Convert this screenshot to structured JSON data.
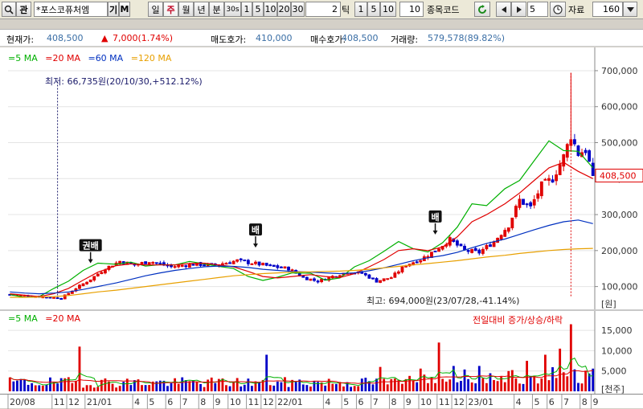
{
  "toolbar": {
    "search_icon": "search-icon",
    "code_btn": "관",
    "stock_name": "*포스코퓨처엠",
    "gi_btn": "기",
    "m_btn": "M",
    "periods": [
      "일",
      "주",
      "월",
      "년",
      "분",
      "30s"
    ],
    "period_selected": "주",
    "minute_opts": [
      "1",
      "5",
      "10",
      "20",
      "30"
    ],
    "tick_input": "2",
    "tick_label": "틱",
    "tick_opts": [
      "1",
      "5",
      "10"
    ],
    "tick_value": "10",
    "code_label": "종목코드",
    "count_value": "5",
    "data_label": "자료",
    "data_count": "160"
  },
  "info": {
    "current_label": "현재가:",
    "current_value": "408,500",
    "change_arrow": "▲",
    "change_value": "7,000(1.74%)",
    "ask_label": "매도호가:",
    "ask_value": "410,000",
    "bid_label": "매수호가:",
    "bid_value": "408,500",
    "volume_label": "거래량:",
    "volume_value": "579,578(89.82%)"
  },
  "price_legend": [
    {
      "label": "5 MA",
      "color": "#00b000"
    },
    {
      "label": "20 MA",
      "color": "#e00000"
    },
    {
      "label": "60 MA",
      "color": "#0030c0"
    },
    {
      "label": "120 MA",
      "color": "#e8a000"
    }
  ],
  "volume_legend": [
    {
      "label": "5 MA",
      "color": "#00b000"
    },
    {
      "label": "20 MA",
      "color": "#e00000"
    }
  ],
  "annotations": {
    "low": "최저: 66,735원(20/10/30,+512.12%)",
    "high": "최고: 694,000원(23/07/28,-41.14%)",
    "volume_title": "전일대비 증가/상승/하락",
    "markers": [
      "권배",
      "배",
      "배"
    ]
  },
  "colors": {
    "up": "#e00000",
    "down": "#0000c8",
    "badge_bg": "#e00000",
    "ma5": "#00b000",
    "ma20": "#e00000",
    "ma60": "#0030c0",
    "ma120": "#e8a000"
  },
  "chart_data": {
    "type": "candlestick",
    "price_axis": {
      "ticks": [
        "700,000",
        "600,000",
        "500,000",
        "400,000",
        "300,000",
        "200,000",
        "100,000"
      ],
      "unit": "[원]",
      "current_label": "408,500",
      "ylim": [
        50000,
        720000
      ]
    },
    "volume_axis": {
      "ticks": [
        "15,000",
        "10,000",
        "5,000"
      ],
      "unit": "[천주]",
      "ylim": [
        0,
        17000
      ]
    },
    "x_labels": [
      "20/08",
      "11",
      "12",
      "21/01",
      "4",
      "5",
      "6",
      "7",
      "8",
      "9",
      "10",
      "11",
      "12",
      "22/01",
      "4",
      "5",
      "6",
      "7",
      "8",
      "9",
      "10",
      "11",
      "12",
      "23/01",
      "4",
      "5",
      "6",
      "7",
      "8",
      "9"
    ],
    "close_trend": [
      {
        "w": 0,
        "p": 78000
      },
      {
        "w": 10,
        "p": 70000
      },
      {
        "w": 14,
        "p": 68000
      },
      {
        "w": 18,
        "p": 95000
      },
      {
        "w": 22,
        "p": 120000
      },
      {
        "w": 26,
        "p": 150000
      },
      {
        "w": 30,
        "p": 170000
      },
      {
        "w": 34,
        "p": 160000
      },
      {
        "w": 38,
        "p": 170000
      },
      {
        "w": 44,
        "p": 155000
      },
      {
        "w": 50,
        "p": 162000
      },
      {
        "w": 56,
        "p": 160000
      },
      {
        "w": 62,
        "p": 172000
      },
      {
        "w": 68,
        "p": 162000
      },
      {
        "w": 72,
        "p": 155000
      },
      {
        "w": 76,
        "p": 150000
      },
      {
        "w": 80,
        "p": 125000
      },
      {
        "w": 84,
        "p": 115000
      },
      {
        "w": 88,
        "p": 128000
      },
      {
        "w": 92,
        "p": 140000
      },
      {
        "w": 96,
        "p": 137000
      },
      {
        "w": 100,
        "p": 115000
      },
      {
        "w": 104,
        "p": 125000
      },
      {
        "w": 108,
        "p": 160000
      },
      {
        "w": 112,
        "p": 175000
      },
      {
        "w": 116,
        "p": 200000
      },
      {
        "w": 120,
        "p": 230000
      },
      {
        "w": 124,
        "p": 200000
      },
      {
        "w": 128,
        "p": 195000
      },
      {
        "w": 132,
        "p": 225000
      },
      {
        "w": 136,
        "p": 270000
      },
      {
        "w": 139,
        "p": 340000
      },
      {
        "w": 142,
        "p": 320000
      },
      {
        "w": 145,
        "p": 380000
      },
      {
        "w": 148,
        "p": 400000
      },
      {
        "w": 151,
        "p": 460000
      },
      {
        "w": 153,
        "p": 520000
      },
      {
        "w": 155,
        "p": 470000
      },
      {
        "w": 157,
        "p": 480000
      },
      {
        "w": 159,
        "p": 408500
      }
    ],
    "series": [
      {
        "name": "5 MA",
        "values": [
          78000,
          70000,
          72000,
          95000,
          115000,
          145000,
          165000,
          162000,
          168000,
          157000,
          161000,
          160000,
          170000,
          163000,
          156000,
          150000,
          128000,
          117000,
          126000,
          138000,
          137000,
          118000,
          124000,
          155000,
          172000,
          198000,
          225000,
          205000,
          196000,
          222000,
          265000,
          330000,
          325000,
          372000,
          395000,
          450000,
          505000,
          478000,
          476000,
          430000
        ]
      },
      {
        "name": "20 MA",
        "values": [
          80000,
          76000,
          72000,
          80000,
          95000,
          118000,
          140000,
          158000,
          163000,
          160000,
          160000,
          160000,
          164000,
          165000,
          160000,
          155000,
          142000,
          128000,
          124000,
          128000,
          133000,
          128000,
          125000,
          136000,
          155000,
          175000,
          200000,
          205000,
          200000,
          210000,
          238000,
          280000,
          300000,
          330000,
          360000,
          395000,
          430000,
          445000,
          420000,
          400000
        ]
      },
      {
        "name": "60 MA",
        "values": [
          85000,
          82000,
          80000,
          82000,
          85000,
          92000,
          100000,
          110000,
          120000,
          130000,
          138000,
          145000,
          150000,
          155000,
          157000,
          156000,
          153000,
          148000,
          145000,
          142000,
          140000,
          138000,
          136000,
          138000,
          144000,
          152000,
          162000,
          172000,
          180000,
          186000,
          195000,
          208000,
          220000,
          232000,
          245000,
          258000,
          270000,
          280000,
          285000,
          275000
        ]
      },
      {
        "name": "120 MA",
        "values": [
          70000,
          70000,
          71000,
          72000,
          75000,
          80000,
          85000,
          90000,
          95000,
          100000,
          105000,
          110000,
          115000,
          120000,
          125000,
          130000,
          133000,
          136000,
          138000,
          140000,
          141000,
          142000,
          143000,
          145000,
          148000,
          152000,
          156000,
          160000,
          164000,
          168000,
          172000,
          177000,
          182000,
          187000,
          192000,
          196000,
          200000,
          203000,
          205000,
          206000
        ]
      }
    ],
    "volume_peaks": [
      {
        "label": "21/01",
        "v": 11000
      },
      {
        "label": "22/01",
        "v": 9000
      },
      {
        "label": "23/01",
        "v": 12000
      },
      {
        "label": "7",
        "v": 16500
      }
    ]
  }
}
